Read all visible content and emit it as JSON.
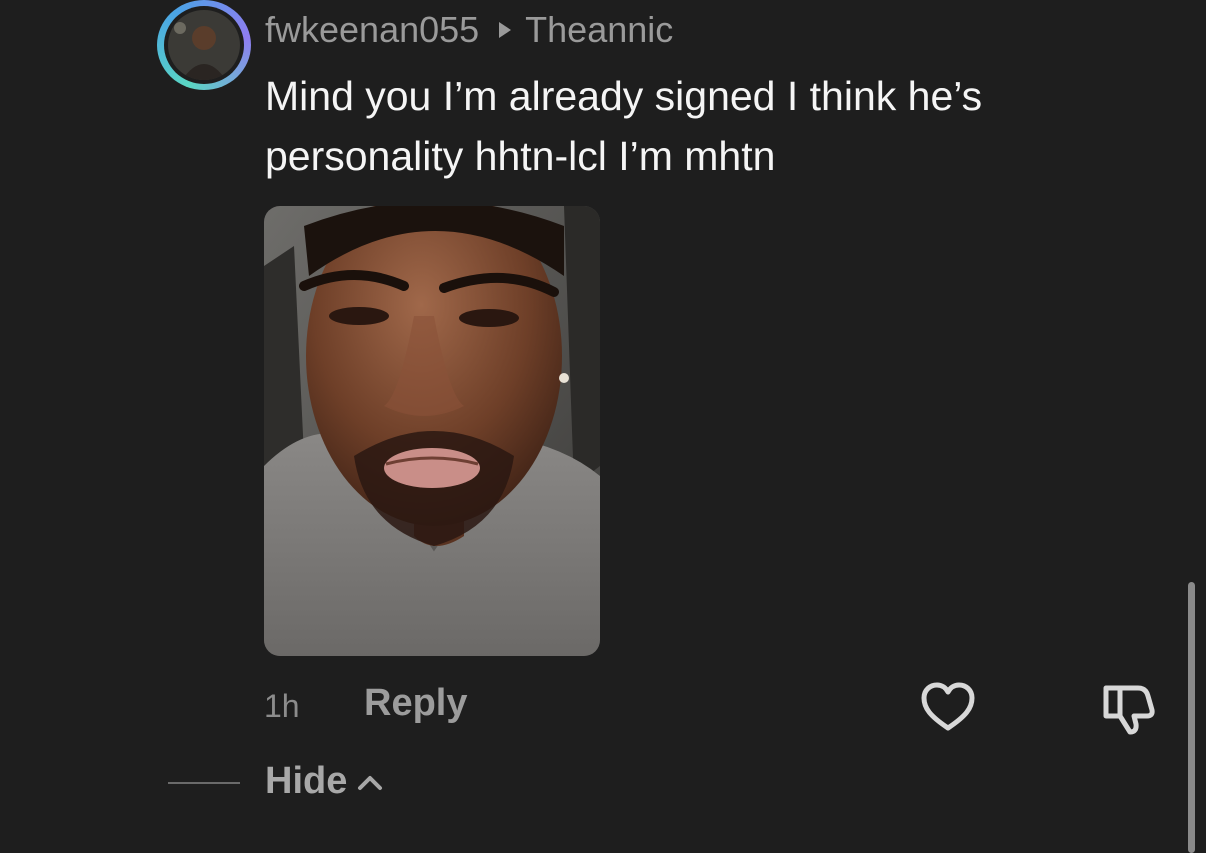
{
  "comment": {
    "username": "fwkeenan055",
    "reply_to": "Theannic",
    "text": "Mind you I’m already signed I think he’s personality hhtn-lcl I’m mhtn",
    "time": "1h",
    "reply_label": "Reply",
    "hide_label": "Hide"
  },
  "icons": {
    "separator": "triangle-right-icon",
    "like": "heart-icon",
    "dislike": "thumbs-down-icon",
    "collapse": "chevron-up-icon"
  },
  "colors": {
    "background": "#1e1e1e",
    "muted_text": "#9a9a9a",
    "primary_text": "#f5f5f5",
    "avatar_ring": "#5ad7c3"
  }
}
